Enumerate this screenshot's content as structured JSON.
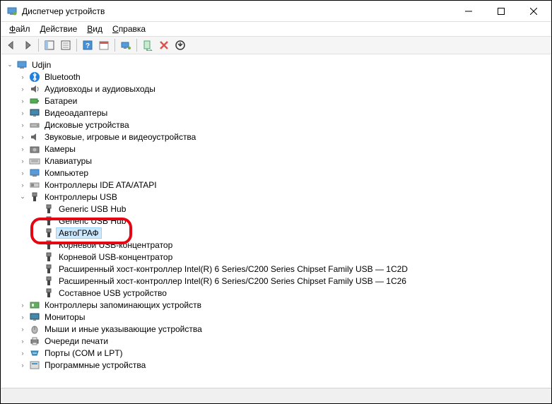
{
  "window": {
    "title": "Диспетчер устройств"
  },
  "menu": {
    "file": "Файл",
    "action": "Действие",
    "view": "Вид",
    "help": "Справка"
  },
  "tree": {
    "root": "Udjin",
    "bluetooth": "Bluetooth",
    "audio": "Аудиовходы и аудиовыходы",
    "batteries": "Батареи",
    "video_adapters": "Видеоадаптеры",
    "disk_drives": "Дисковые устройства",
    "sound_video_game": "Звуковые, игровые и видеоустройства",
    "cameras": "Камеры",
    "keyboards": "Клавиатуры",
    "computer": "Компьютер",
    "ide_ata": "Контроллеры IDE ATA/ATAPI",
    "usb_controllers": "Контроллеры USB",
    "usb": {
      "generic_hub_1": "Generic USB Hub",
      "generic_hub_2": "Generic USB Hub",
      "autograf": "АвтоГРАФ",
      "root_hub_1": "Корневой USB-концентратор",
      "root_hub_2": "Корневой USB-концентратор",
      "host_2d": "Расширенный хост-контроллер Intel(R) 6 Series/C200 Series Chipset Family USB — 1C2D",
      "host_26": "Расширенный хост-контроллер Intel(R) 6 Series/C200 Series Chipset Family USB — 1C26",
      "composite": "Составное USB устройство"
    },
    "storage_controllers": "Контроллеры запоминающих устройств",
    "monitors": "Мониторы",
    "mice": "Мыши и иные указывающие устройства",
    "print_queues": "Очереди печати",
    "ports": "Порты (COM и LPT)",
    "software_devices": "Программные устройства"
  }
}
